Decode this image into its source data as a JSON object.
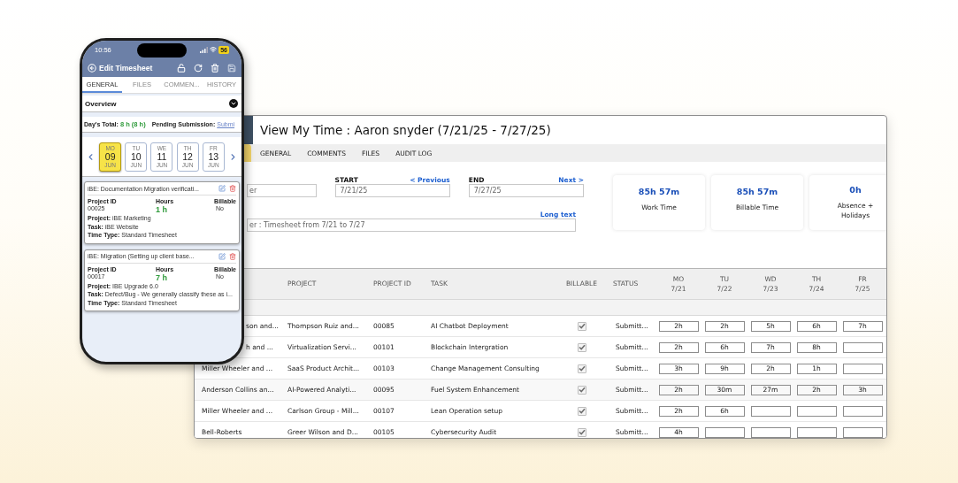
{
  "phone": {
    "status_bar": {
      "time": "10:56",
      "battery": "56"
    },
    "header": {
      "title": "Edit Timesheet"
    },
    "tabs": [
      {
        "label": "GENERAL",
        "selected": true
      },
      {
        "label": "FILES",
        "selected": false
      },
      {
        "label": "COMMEN...",
        "selected": false
      },
      {
        "label": "HISTORY",
        "selected": false
      }
    ],
    "overview": {
      "title": "Overview",
      "expanded": true
    },
    "day_total": {
      "label": "Day's Total:",
      "value": "8 h (8 h)",
      "pending_label": "Pending Submission:",
      "pending_link": "Submi"
    },
    "days": [
      {
        "weekday": "MO",
        "day": "09",
        "month": "JUN",
        "selected": true
      },
      {
        "weekday": "TU",
        "day": "10",
        "month": "JUN",
        "selected": false
      },
      {
        "weekday": "WE",
        "day": "11",
        "month": "JUN",
        "selected": false
      },
      {
        "weekday": "TH",
        "day": "12",
        "month": "JUN",
        "selected": false
      },
      {
        "weekday": "FR",
        "day": "13",
        "month": "JUN",
        "selected": false
      }
    ],
    "entries": [
      {
        "title": "iBE: Documentation Migration verificati...",
        "project_id_label": "Project ID",
        "project_id": "00025",
        "hours_label": "Hours",
        "hours": "1 h",
        "billable_label": "Billable",
        "billable": "No",
        "project_label": "Project:",
        "project": "iBE Marketing",
        "task_label": "Task:",
        "task": "iBE Website",
        "time_type_label": "Time Type:",
        "time_type": "Standard Timesheet"
      },
      {
        "title": "iBE: Migration (Setting up client base...",
        "project_id_label": "Project ID",
        "project_id": "00017",
        "hours_label": "Hours",
        "hours": "7 h",
        "billable_label": "Billable",
        "billable": "No",
        "project_label": "Project:",
        "project": "IBE Upgrade 6.0",
        "task_label": "Task:",
        "task": "Defect/Bug - We generally classify these as i...",
        "time_type_label": "Time Type:",
        "time_type": "Standard Timesheet"
      }
    ]
  },
  "desktop": {
    "title": "View My Time : Aaron snyder (7/21/25 - 7/27/25)",
    "tabs": [
      {
        "label": "GENERAL",
        "selected": false
      },
      {
        "label": "COMMENTS",
        "selected": false
      },
      {
        "label": "FILES",
        "selected": false
      },
      {
        "label": "AUDIT LOG",
        "selected": false
      }
    ],
    "filter": {
      "value": "er"
    },
    "start": {
      "label": "START",
      "link": "< Previous",
      "value": "7/21/25"
    },
    "end": {
      "label": "END",
      "link": "Next >",
      "value": "7/27/25"
    },
    "description": {
      "link": "Long text",
      "value": "er : Timesheet from 7/21 to 7/27"
    },
    "summary": [
      {
        "value": "85h 57m",
        "label": "Work Time"
      },
      {
        "value": "85h 57m",
        "label": "Billable Time"
      },
      {
        "value": "0h",
        "label": "Absence + Holidays"
      }
    ],
    "table": {
      "columns": [
        {
          "label": "PROJECT"
        },
        {
          "label": "PROJECT ID"
        },
        {
          "label": "TASK"
        },
        {
          "label": "BILLABLE"
        },
        {
          "label": "STATUS"
        }
      ],
      "days": [
        {
          "label": "MO",
          "date": "7/21"
        },
        {
          "label": "TU",
          "date": "7/22"
        },
        {
          "label": "WD",
          "date": "7/23"
        },
        {
          "label": "TH",
          "date": "7/24"
        },
        {
          "label": "FR",
          "date": "7/25"
        }
      ],
      "rows": [
        {
          "client": "son and...",
          "project": "Thompson Ruiz and...",
          "project_id": "00085",
          "task": "AI Chatbot Deployment",
          "billable": true,
          "status": "Submitt...",
          "hours": [
            "2h",
            "2h",
            "5h",
            "6h",
            "7h"
          ]
        },
        {
          "client": "h and ...",
          "project": "Virtualization Servi...",
          "project_id": "00101",
          "task": "Blockchain Intergration",
          "billable": true,
          "status": "Submitt...",
          "hours": [
            "2h",
            "6h",
            "7h",
            "8h"
          ]
        },
        {
          "client": "Miller Wheeler and ...",
          "project": "SaaS Product Archit...",
          "project_id": "00103",
          "task": "Change Management Consulting",
          "billable": true,
          "status": "Submitt...",
          "hours": [
            "3h",
            "9h",
            "2h",
            "1h"
          ]
        },
        {
          "client": "Anderson Collins an...",
          "project": "AI-Powered Analyti...",
          "project_id": "00095",
          "task": "Fuel System Enhancement",
          "billable": true,
          "status": "Submitt...",
          "hours": [
            "2h",
            "30m",
            "27m",
            "2h",
            "3h"
          ]
        },
        {
          "client": "Miller Wheeler and ...",
          "project": "Carlson Group - Mill...",
          "project_id": "00107",
          "task": "Lean Operation setup",
          "billable": true,
          "status": "Submitt...",
          "hours": [
            "2h",
            "6h"
          ]
        },
        {
          "client": "Bell-Roberts",
          "project": "Greer Wilson and D...",
          "project_id": "00105",
          "task": "Cybersecurity Audit",
          "billable": true,
          "status": "Submitt...",
          "hours": [
            "4h"
          ]
        }
      ]
    }
  }
}
